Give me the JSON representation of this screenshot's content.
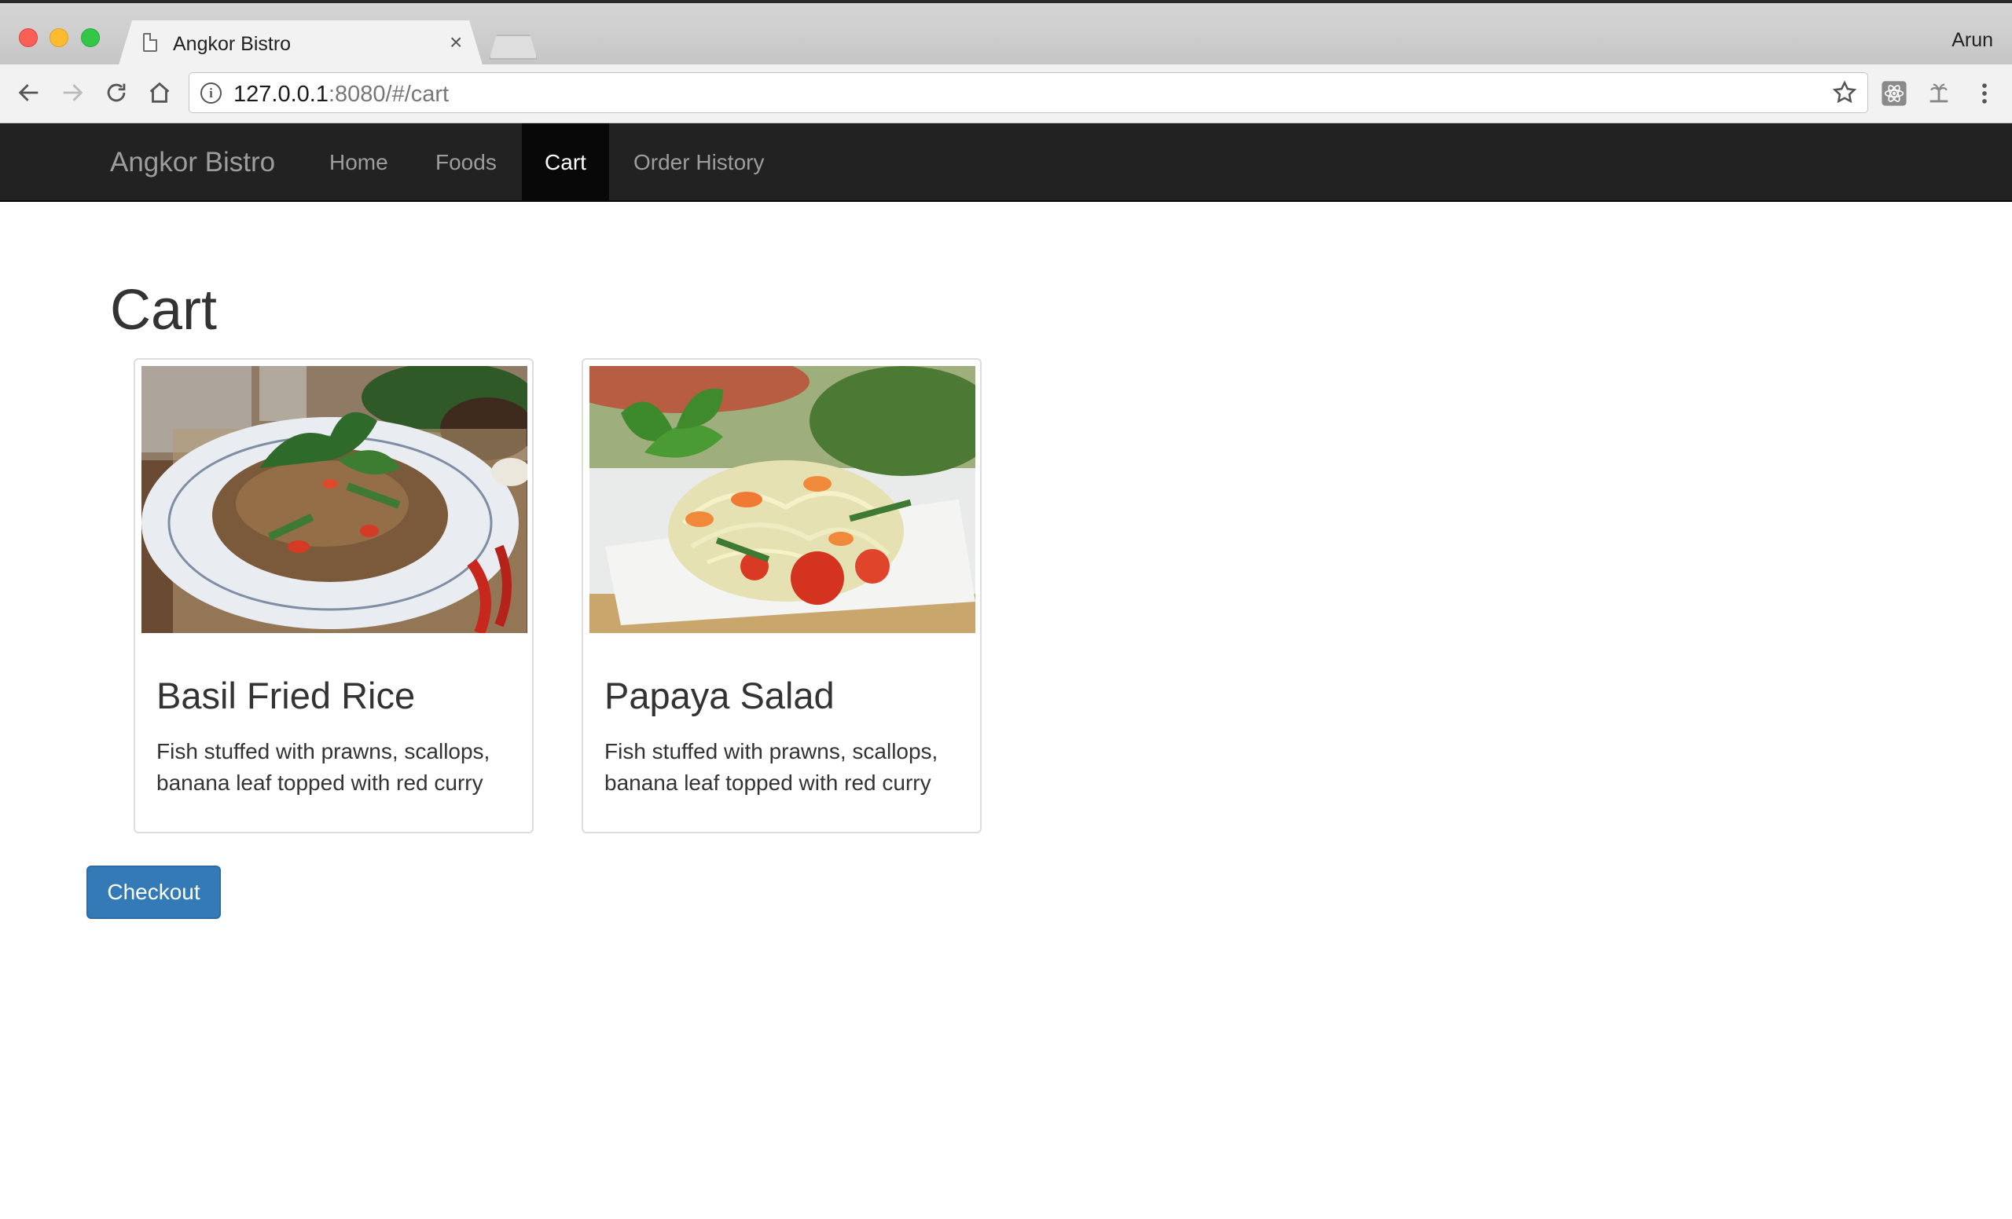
{
  "browser": {
    "tab_title": "Angkor Bistro",
    "tab_close": "×",
    "profile_name": "Arun",
    "url_host": "127.0.0.1",
    "url_rest": ":8080/#/cart"
  },
  "navbar": {
    "brand": "Angkor Bistro",
    "links": [
      {
        "label": "Home",
        "active": false
      },
      {
        "label": "Foods",
        "active": false
      },
      {
        "label": "Cart",
        "active": true
      },
      {
        "label": "Order History",
        "active": false
      }
    ]
  },
  "page": {
    "heading": "Cart"
  },
  "cart_items": [
    {
      "name": "Basil Fried Rice",
      "description": "Fish stuffed with prawns, scallops, banana leaf topped with red curry",
      "image_icon": "basil-fried-rice-photo"
    },
    {
      "name": "Papaya Salad",
      "description": "Fish stuffed with prawns, scallops, banana leaf topped with red curry",
      "image_icon": "papaya-salad-photo"
    }
  ],
  "actions": {
    "checkout_label": "Checkout"
  },
  "colors": {
    "navbar_bg": "#222222",
    "navbar_active_bg": "#080808",
    "primary_button": "#337ab7"
  }
}
